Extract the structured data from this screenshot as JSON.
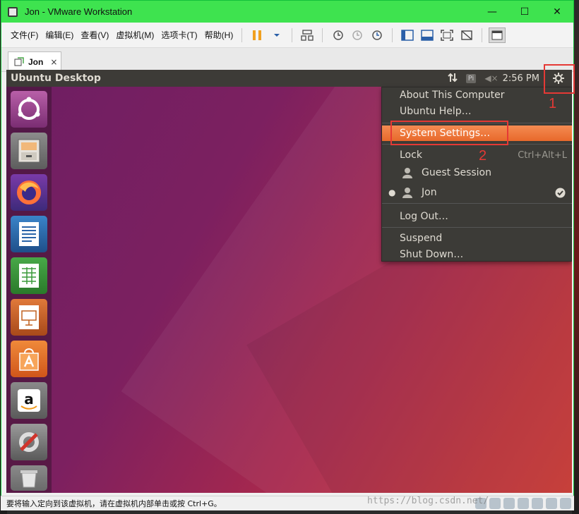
{
  "window": {
    "title": "Jon - VMware Workstation",
    "minimize": "—",
    "maximize": "☐",
    "close": "✕"
  },
  "menu": {
    "items": [
      "文件(F)",
      "编辑(E)",
      "查看(V)",
      "虚拟机(M)",
      "选项卡(T)",
      "帮助(H)"
    ]
  },
  "tab": {
    "label": "Jon",
    "close": "×"
  },
  "ubuntu": {
    "panel_title": "Ubuntu Desktop",
    "pi_label": "Pi",
    "volume_symbol": "◀×",
    "clock": "2:56 PM"
  },
  "session_menu": {
    "about": "About This Computer",
    "help": "Ubuntu Help…",
    "settings": "System Settings…",
    "lock": "Lock",
    "lock_shortcut": "Ctrl+Alt+L",
    "guest": "Guest Session",
    "user": "Jon",
    "logout": "Log Out…",
    "suspend": "Suspend",
    "shutdown": "Shut Down…"
  },
  "annotations": {
    "one": "1",
    "two": "2"
  },
  "status": {
    "text": "要将输入定向到该虚拟机，请在虚拟机内部单击或按 Ctrl+G。"
  },
  "watermark": "https://blog.csdn.net/",
  "colors": {
    "titlebar": "#3ee34f",
    "highlight": "#e8692b",
    "annotation": "#e53935"
  }
}
